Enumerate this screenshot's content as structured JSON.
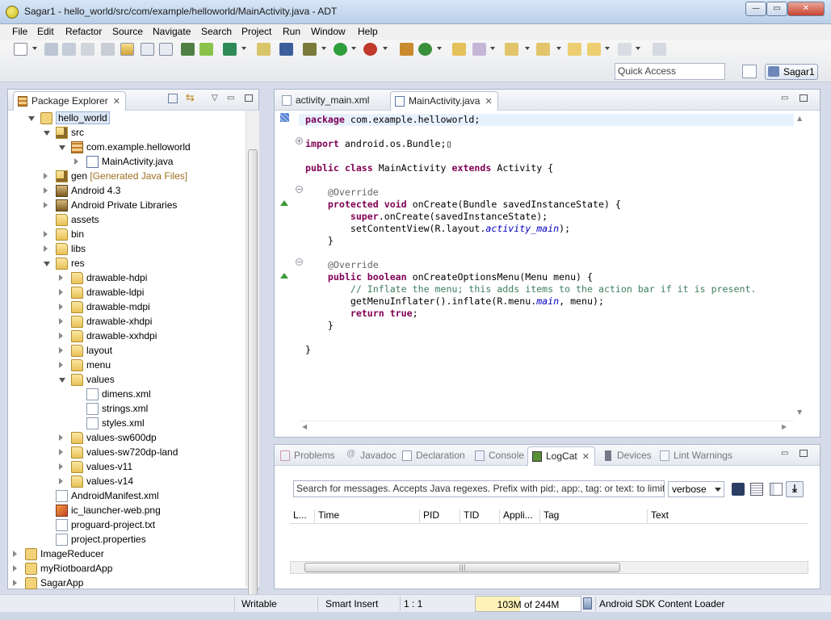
{
  "window": {
    "title": "Sagar1 - hello_world/src/com/example/helloworld/MainActivity.java - ADT"
  },
  "menu": [
    "File",
    "Edit",
    "Refactor",
    "Source",
    "Navigate",
    "Search",
    "Project",
    "Run",
    "Window",
    "Help"
  ],
  "toolbar": {
    "quick_access_placeholder": "Quick Access",
    "perspective": "Sagar1"
  },
  "package_explorer": {
    "title": "Package Explorer",
    "tree": [
      {
        "label": "hello_world",
        "depth": 1,
        "icon": "project-icon",
        "tw": "open",
        "selected": true
      },
      {
        "label": "src",
        "depth": 2,
        "icon": "source-folder-icon",
        "tw": "open"
      },
      {
        "label": "com.example.helloworld",
        "depth": 3,
        "icon": "package-icon",
        "tw": "open"
      },
      {
        "label": "MainActivity.java",
        "depth": 4,
        "icon": "java-file-icon",
        "tw": "closed"
      },
      {
        "label": "gen",
        "suffix": "[Generated Java Files]",
        "depth": 2,
        "icon": "source-folder-icon",
        "tw": "closed"
      },
      {
        "label": "Android 4.3",
        "depth": 2,
        "icon": "library-icon",
        "tw": "closed"
      },
      {
        "label": "Android Private Libraries",
        "depth": 2,
        "icon": "library-icon",
        "tw": "closed"
      },
      {
        "label": "assets",
        "depth": 2,
        "icon": "folder-icon",
        "tw": ""
      },
      {
        "label": "bin",
        "depth": 2,
        "icon": "folder-icon",
        "tw": "closed"
      },
      {
        "label": "libs",
        "depth": 2,
        "icon": "folder-icon",
        "tw": "closed"
      },
      {
        "label": "res",
        "depth": 2,
        "icon": "folder-icon",
        "tw": "open"
      },
      {
        "label": "drawable-hdpi",
        "depth": 3,
        "icon": "folder-icon",
        "tw": "closed"
      },
      {
        "label": "drawable-ldpi",
        "depth": 3,
        "icon": "folder-icon",
        "tw": "closed"
      },
      {
        "label": "drawable-mdpi",
        "depth": 3,
        "icon": "folder-icon",
        "tw": "closed"
      },
      {
        "label": "drawable-xhdpi",
        "depth": 3,
        "icon": "folder-icon",
        "tw": "closed"
      },
      {
        "label": "drawable-xxhdpi",
        "depth": 3,
        "icon": "folder-icon",
        "tw": "closed"
      },
      {
        "label": "layout",
        "depth": 3,
        "icon": "folder-icon",
        "tw": "closed"
      },
      {
        "label": "menu",
        "depth": 3,
        "icon": "folder-icon",
        "tw": "closed"
      },
      {
        "label": "values",
        "depth": 3,
        "icon": "folder-icon",
        "tw": "open"
      },
      {
        "label": "dimens.xml",
        "depth": 4,
        "icon": "xml-file-icon",
        "tw": ""
      },
      {
        "label": "strings.xml",
        "depth": 4,
        "icon": "xml-file-icon",
        "tw": ""
      },
      {
        "label": "styles.xml",
        "depth": 4,
        "icon": "xml-file-icon",
        "tw": ""
      },
      {
        "label": "values-sw600dp",
        "depth": 3,
        "icon": "folder-icon",
        "tw": "closed"
      },
      {
        "label": "values-sw720dp-land",
        "depth": 3,
        "icon": "folder-icon",
        "tw": "closed"
      },
      {
        "label": "values-v11",
        "depth": 3,
        "icon": "folder-icon",
        "tw": "closed"
      },
      {
        "label": "values-v14",
        "depth": 3,
        "icon": "folder-icon",
        "tw": "closed"
      },
      {
        "label": "AndroidManifest.xml",
        "depth": 2,
        "icon": "xml-file-icon",
        "tw": ""
      },
      {
        "label": "ic_launcher-web.png",
        "depth": 2,
        "icon": "image-file-icon",
        "tw": ""
      },
      {
        "label": "proguard-project.txt",
        "depth": 2,
        "icon": "text-file-icon",
        "tw": ""
      },
      {
        "label": "project.properties",
        "depth": 2,
        "icon": "text-file-icon",
        "tw": ""
      },
      {
        "label": "ImageReducer",
        "depth": 0,
        "icon": "project-icon",
        "tw": "closed"
      },
      {
        "label": "myRiotboardApp",
        "depth": 0,
        "icon": "project-icon",
        "tw": "closed"
      },
      {
        "label": "SagarApp",
        "depth": 0,
        "icon": "project-icon",
        "tw": "closed"
      }
    ]
  },
  "editor": {
    "tabs": [
      {
        "label": "activity_main.xml",
        "active": false
      },
      {
        "label": "MainActivity.java",
        "active": true
      }
    ],
    "code": [
      [
        [
          "kw",
          "package"
        ],
        [
          "",
          "com.example.helloworld;"
        ]
      ],
      [],
      [
        [
          "kw",
          "import"
        ],
        [
          "",
          "android.os.Bundle;▯"
        ]
      ],
      [],
      [
        [
          "kw",
          "public class"
        ],
        [
          "",
          "MainActivity "
        ],
        [
          "kw",
          "extends"
        ],
        [
          "",
          " Activity {"
        ]
      ],
      [],
      [
        [
          "",
          "    "
        ],
        [
          "ann",
          "@Override"
        ]
      ],
      [
        [
          "",
          "    "
        ],
        [
          "kw",
          "protected void"
        ],
        [
          "",
          " onCreate(Bundle savedInstanceState) {"
        ]
      ],
      [
        [
          "",
          "        "
        ],
        [
          "kw",
          "super"
        ],
        [
          "",
          ".onCreate(savedInstanceState);"
        ]
      ],
      [
        [
          "",
          "        setContentView(R.layout."
        ],
        [
          "fld",
          "activity_main"
        ],
        [
          "",
          ");"
        ]
      ],
      [
        [
          "",
          "    }"
        ]
      ],
      [],
      [
        [
          "",
          "    "
        ],
        [
          "ann",
          "@Override"
        ]
      ],
      [
        [
          "",
          "    "
        ],
        [
          "kw",
          "public boolean"
        ],
        [
          "",
          " onCreateOptionsMenu(Menu menu) {"
        ]
      ],
      [
        [
          "",
          "        "
        ],
        [
          "cmt",
          "// Inflate the menu; this adds items to the action bar if it is present."
        ]
      ],
      [
        [
          "",
          "        getMenuInflater().inflate(R.menu."
        ],
        [
          "fld",
          "main"
        ],
        [
          "",
          ", menu);"
        ]
      ],
      [
        [
          "",
          "        "
        ],
        [
          "kw",
          "return true"
        ],
        [
          "",
          ";"
        ]
      ],
      [
        [
          "",
          "    }"
        ]
      ],
      [],
      [
        [
          "",
          "}"
        ]
      ]
    ]
  },
  "bottom_view": {
    "tabs": [
      "Problems",
      "Javadoc",
      "Declaration",
      "Console",
      "LogCat",
      "Devices",
      "Lint Warnings"
    ],
    "active_tab": "LogCat",
    "search_placeholder": "Search for messages. Accepts Java regexes. Prefix with pid:, app:, tag: or text: to limit scope.",
    "level": "verbose",
    "columns": [
      "L...",
      "Time",
      "PID",
      "TID",
      "Appli...",
      "Tag",
      "Text"
    ]
  },
  "status": {
    "writable": "Writable",
    "insert_mode": "Smart Insert",
    "position": "1 : 1",
    "heap": "103M of 244M",
    "heap_used_fraction": 0.42,
    "job": "Android SDK Content Loader"
  }
}
